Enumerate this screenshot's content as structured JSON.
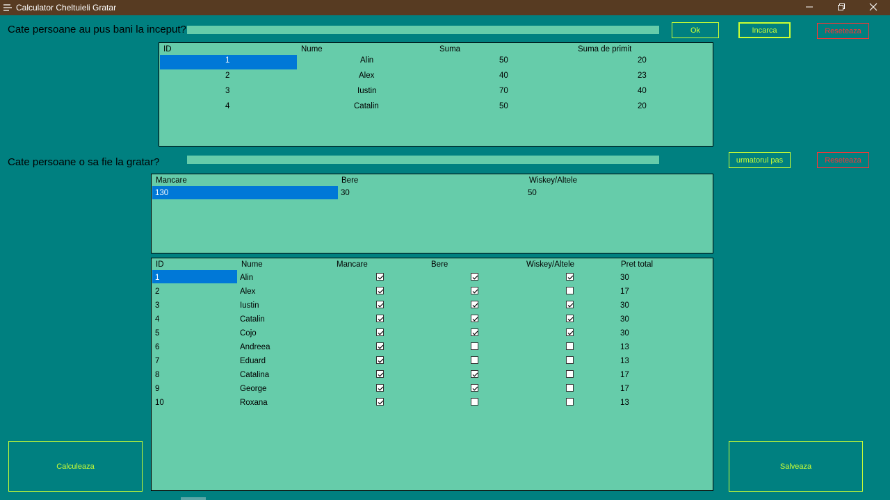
{
  "window": {
    "title": "Calculator Cheltuieli Gratar"
  },
  "section1": {
    "question": "Cate persoane au pus bani la inceput?",
    "ok_label": "Ok",
    "load_label": "Incarca",
    "reset_label": "Reseteaza",
    "columns": [
      "ID",
      "Nume",
      "Suma",
      "Suma de primit"
    ],
    "rows": [
      {
        "id": "1",
        "name": "Alin",
        "sum": "50",
        "receive": "20"
      },
      {
        "id": "2",
        "name": "Alex",
        "sum": "40",
        "receive": "23"
      },
      {
        "id": "3",
        "name": "Iustin",
        "sum": "70",
        "receive": "40"
      },
      {
        "id": "4",
        "name": "Catalin",
        "sum": "50",
        "receive": "20"
      }
    ]
  },
  "section2": {
    "question": "Cate persoane o sa fie la gratar?",
    "next_label": "urmatorul pas",
    "reset_label": "Reseteaza",
    "columns": [
      "Mancare",
      "Bere",
      "Wiskey/Altele"
    ],
    "values": [
      "130",
      "30",
      "50"
    ]
  },
  "section3": {
    "columns": [
      "ID",
      "Nume",
      "Mancare",
      "Bere",
      "Wiskey/Altele",
      "Pret total"
    ],
    "rows": [
      {
        "id": "1",
        "name": "Alin",
        "food": true,
        "beer": true,
        "whiskey": true,
        "total": "30"
      },
      {
        "id": "2",
        "name": "Alex",
        "food": true,
        "beer": true,
        "whiskey": false,
        "total": "17"
      },
      {
        "id": "3",
        "name": "Iustin",
        "food": true,
        "beer": true,
        "whiskey": true,
        "total": "30"
      },
      {
        "id": "4",
        "name": "Catalin",
        "food": true,
        "beer": true,
        "whiskey": true,
        "total": "30"
      },
      {
        "id": "5",
        "name": "Cojo",
        "food": true,
        "beer": true,
        "whiskey": true,
        "total": "30"
      },
      {
        "id": "6",
        "name": "Andreea",
        "food": true,
        "beer": false,
        "whiskey": false,
        "total": "13"
      },
      {
        "id": "7",
        "name": "Eduard",
        "food": true,
        "beer": false,
        "whiskey": false,
        "total": "13"
      },
      {
        "id": "8",
        "name": "Catalina",
        "food": true,
        "beer": true,
        "whiskey": false,
        "total": "17"
      },
      {
        "id": "9",
        "name": "George",
        "food": true,
        "beer": true,
        "whiskey": false,
        "total": "17"
      },
      {
        "id": "10",
        "name": "Roxana",
        "food": true,
        "beer": false,
        "whiskey": false,
        "total": "13"
      }
    ]
  },
  "actions": {
    "calculate_label": "Calculeaza",
    "save_label": "Salveaza"
  },
  "colors": {
    "background": "#008080",
    "grid": "#66ccaa",
    "titlebar": "#573b22",
    "accent_green": "#ccff33",
    "accent_red": "#ff3333",
    "selection": "#0078d7"
  },
  "icons": {
    "app": "menu-lines-icon",
    "minimize": "minimize-icon",
    "restore": "restore-icon",
    "close": "close-icon"
  }
}
